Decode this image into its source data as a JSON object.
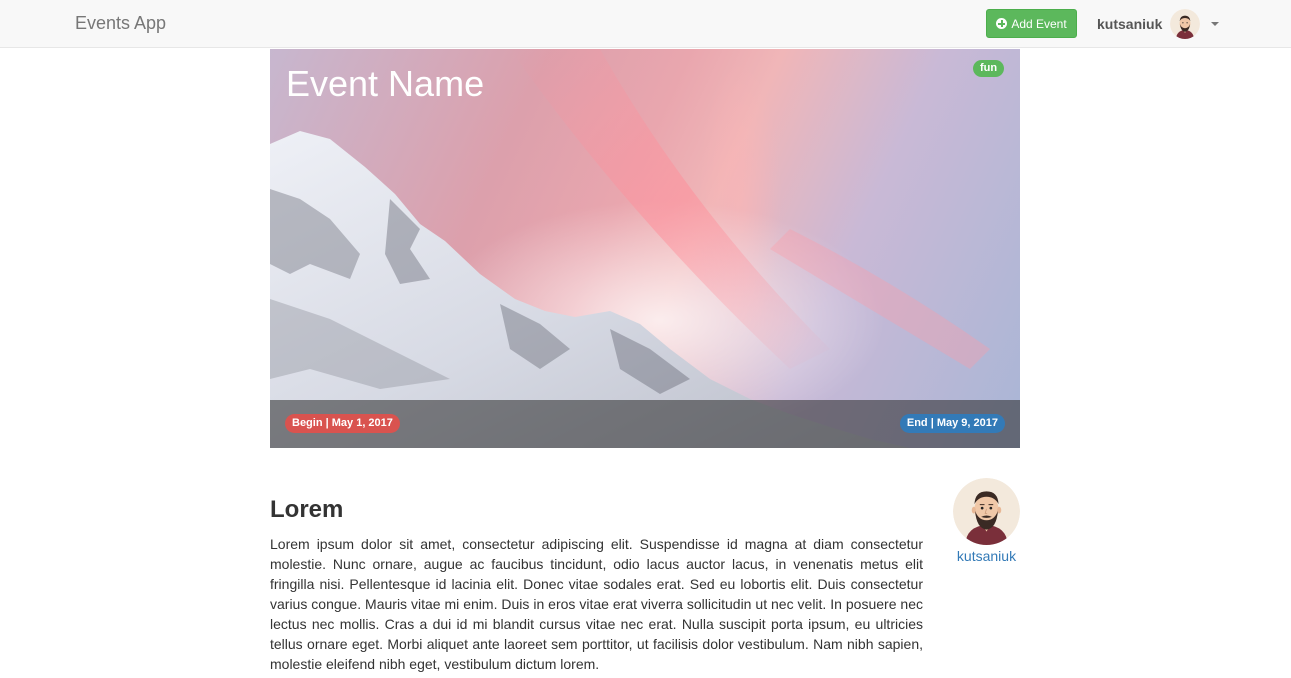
{
  "navbar": {
    "brand": "Events App",
    "add_button_label": "Add Event",
    "add_button_icon": "plus-circle-icon",
    "user_name": "kutsaniuk"
  },
  "event": {
    "name": "Event Name",
    "tag": "fun",
    "begin": "Begin | May 1, 2017",
    "end": "End | May 9, 2017"
  },
  "content": {
    "heading": "Lorem",
    "body": "Lorem ipsum dolor sit amet, consectetur adipiscing elit. Suspendisse id magna at diam consectetur molestie. Nunc ornare, augue ac faucibus tincidunt, odio lacus auctor lacus, in venenatis metus elit fringilla nisi. Pellentesque id lacinia elit. Donec vitae sodales erat. Sed eu lobortis elit. Duis consectetur varius congue. Mauris vitae mi enim. Duis in eros vitae erat viverra sollicitudin ut nec velit. In posuere nec lectus nec mollis. Cras a dui id mi blandit cursus vitae nec erat. Nulla suscipit porta ipsum, eu ultricies tellus ornare eget. Morbi aliquet ante laoreet sem porttitor, ut facilisis dolor vestibulum. Nam nibh sapien, molestie eleifend nibh eget, vestibulum dictum lorem."
  },
  "author": {
    "name": "kutsaniuk"
  },
  "colors": {
    "success": "#5cb85c",
    "danger": "#d9534f",
    "primary": "#337ab7",
    "navbar_bg": "#f8f8f8"
  }
}
